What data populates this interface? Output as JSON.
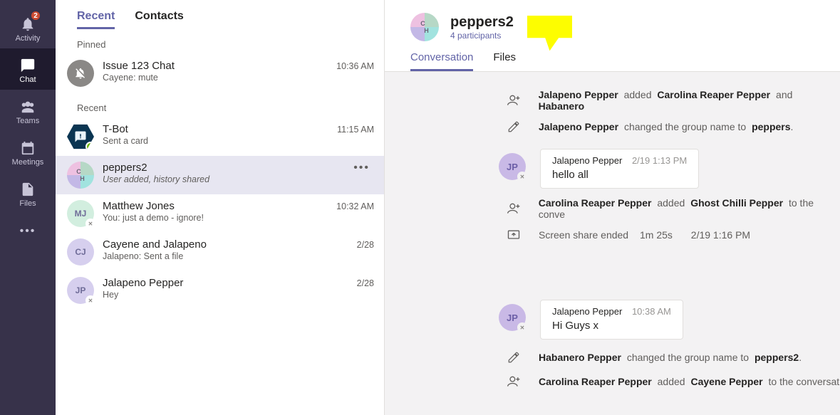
{
  "rail": {
    "items": [
      {
        "label": "Activity",
        "badge": "2"
      },
      {
        "label": "Chat"
      },
      {
        "label": "Teams"
      },
      {
        "label": "Meetings"
      },
      {
        "label": "Files"
      }
    ]
  },
  "list": {
    "tabs": {
      "recent": "Recent",
      "contacts": "Contacts"
    },
    "sections": {
      "pinned": "Pinned",
      "recent": "Recent"
    },
    "pinned": [
      {
        "title": "Issue 123 Chat",
        "sub": "Cayene: mute",
        "time": "10:36 AM"
      }
    ],
    "recent": [
      {
        "title": "T-Bot",
        "sub": "Sent a card",
        "time": "11:15 AM"
      },
      {
        "title": "peppers2",
        "sub": "User added, history shared",
        "time": ""
      },
      {
        "title": "Matthew Jones",
        "sub": "You: just a demo - ignore!",
        "time": "10:32 AM",
        "initials": "MJ"
      },
      {
        "title": "Cayene and Jalapeno",
        "sub": "Jalapeno: Sent a file",
        "time": "2/28",
        "initials": "CJ"
      },
      {
        "title": "Jalapeno Pepper",
        "sub": "Hey",
        "time": "2/28",
        "initials": "JP"
      }
    ]
  },
  "conv": {
    "header": {
      "title": "peppers2",
      "subtitle": "4 participants"
    },
    "tabs": {
      "conversation": "Conversation",
      "files": "Files"
    },
    "feed": {
      "sys1": {
        "actor": "Jalapeno Pepper",
        "verb": "added",
        "target": "Carolina Reaper Pepper",
        "conj": "and",
        "target2": "Habanero"
      },
      "sys2": {
        "actor": "Jalapeno Pepper",
        "verb": "changed the group name to",
        "target": "peppers",
        "tail": "."
      },
      "msg1": {
        "name": "Jalapeno Pepper",
        "ts": "2/19 1:13 PM",
        "body": "hello all",
        "initials": "JP"
      },
      "sys3": {
        "actor": "Carolina Reaper Pepper",
        "verb": "added",
        "target": "Ghost Chilli Pepper",
        "tail": "to the conve"
      },
      "sys4": {
        "text": "Screen share ended",
        "dur": "1m 25s",
        "ts": "2/19 1:16 PM"
      },
      "msg2": {
        "name": "Jalapeno Pepper",
        "ts": "10:38 AM",
        "body": "Hi Guys x",
        "initials": "JP"
      },
      "sys5": {
        "actor": "Habanero Pepper",
        "verb": "changed the group name to",
        "target": "peppers2",
        "tail": "."
      },
      "sys6": {
        "actor": "Carolina Reaper Pepper",
        "verb": "added",
        "target": "Cayene Pepper",
        "tail": "to the conversat"
      }
    }
  }
}
